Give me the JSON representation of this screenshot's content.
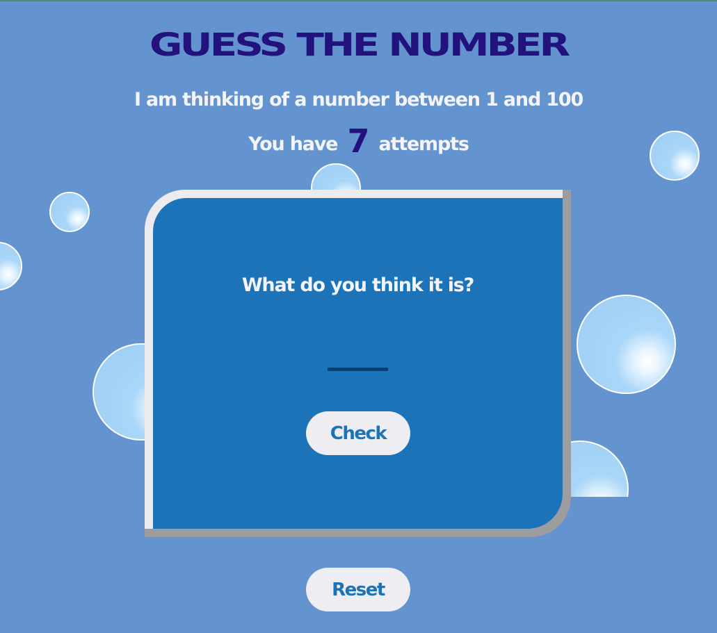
{
  "title": "GUESS THE NUMBER",
  "subtitle": "I am thinking of a number between 1 and 100",
  "attempts": {
    "prefix": "You have",
    "count": "7",
    "suffix": "attempts"
  },
  "card": {
    "prompt": "What do you think it is?",
    "input_value": "",
    "check_label": "Check"
  },
  "reset_label": "Reset",
  "colors": {
    "background": "#6494cf",
    "title": "#23117d",
    "card": "#1d73b8",
    "button": "#eeeef2",
    "bubble": "#9dcdf4"
  }
}
